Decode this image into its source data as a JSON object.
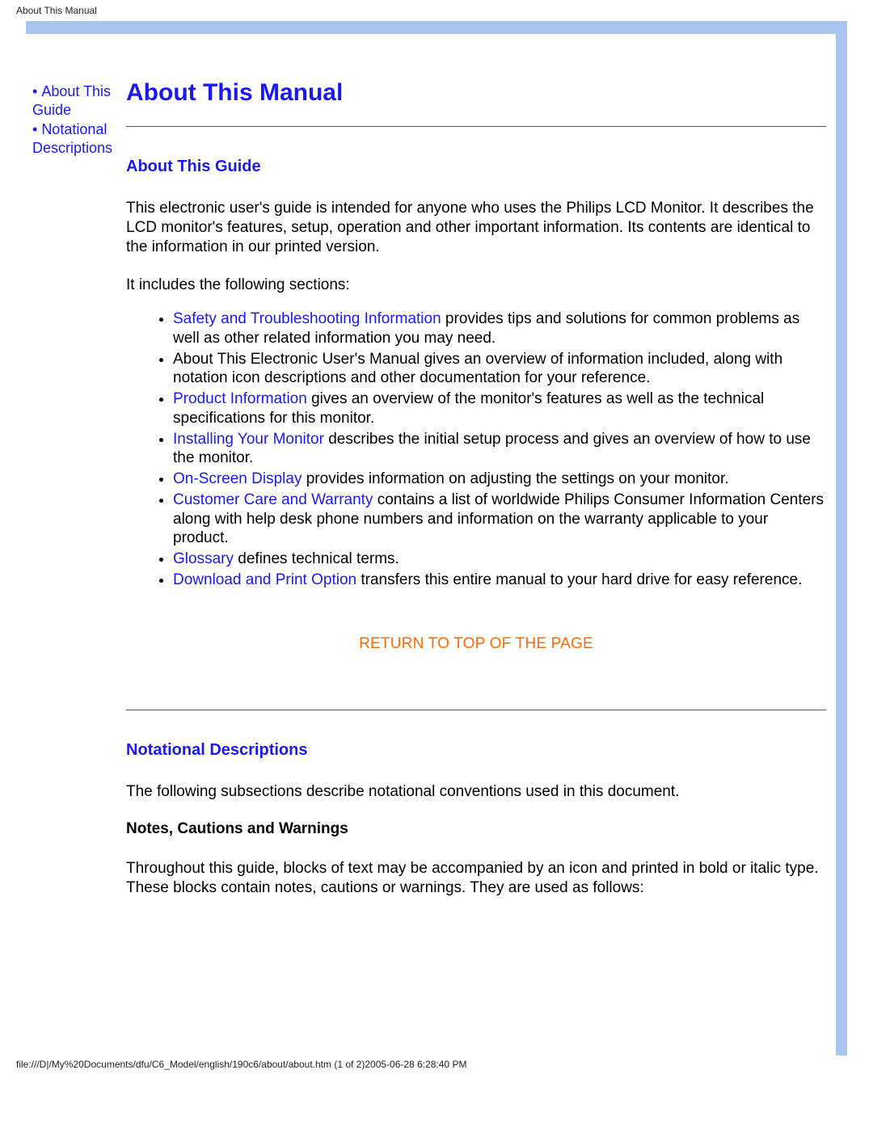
{
  "header": {
    "title": "About This Manual"
  },
  "sidebar": {
    "items": [
      {
        "label": "About This Guide"
      },
      {
        "label": "Notational Descriptions"
      }
    ]
  },
  "main": {
    "title": "About This Manual",
    "section_guide": {
      "heading": "About This Guide",
      "intro": "This electronic user's guide is intended for anyone who uses the Philips LCD Monitor. It describes the LCD monitor's features, setup, operation and other important information. Its contents are identical to the information in our printed version.",
      "includes_label": "It includes the following sections:",
      "items": {
        "safety_link": "Safety and Troubleshooting Information",
        "safety_text": " provides tips and solutions for common problems as well as other related information you may need.",
        "about_text": "About This Electronic User's Manual gives an overview of information included, along with notation icon descriptions and other documentation for your reference.",
        "product_link": "Product Information",
        "product_text": " gives an overview of the monitor's features as well as the technical specifications for this monitor.",
        "install_link": "Installing Your Monitor",
        "install_text": " describes the initial setup process and gives an overview of how to use the monitor.",
        "osd_link": "On-Screen Display",
        "osd_text": " provides information on adjusting the settings on your monitor.",
        "care_link": "Customer Care and Warranty",
        "care_text": " contains a list of worldwide Philips Consumer Information Centers along with help desk phone numbers and information on the warranty applicable to your product.",
        "glossary_link": "Glossary",
        "glossary_text": " defines technical terms.",
        "download_link": "Download and Print Option",
        "download_text": " transfers this entire manual to your hard drive for easy reference."
      }
    },
    "return_top": "RETURN TO TOP OF THE PAGE",
    "section_notation": {
      "heading": "Notational Descriptions",
      "intro": "The following subsections describe notational conventions used in this document.",
      "sub_heading": "Notes, Cautions and Warnings",
      "sub_text": "Throughout this guide, blocks of text may be accompanied by an icon and printed in bold or italic type. These blocks contain notes, cautions or warnings. They are used as follows:"
    }
  },
  "footer": {
    "path": "file:///D|/My%20Documents/dfu/C6_Model/english/190c6/about/about.htm (1 of 2)2005-06-28 6:28:40 PM"
  }
}
